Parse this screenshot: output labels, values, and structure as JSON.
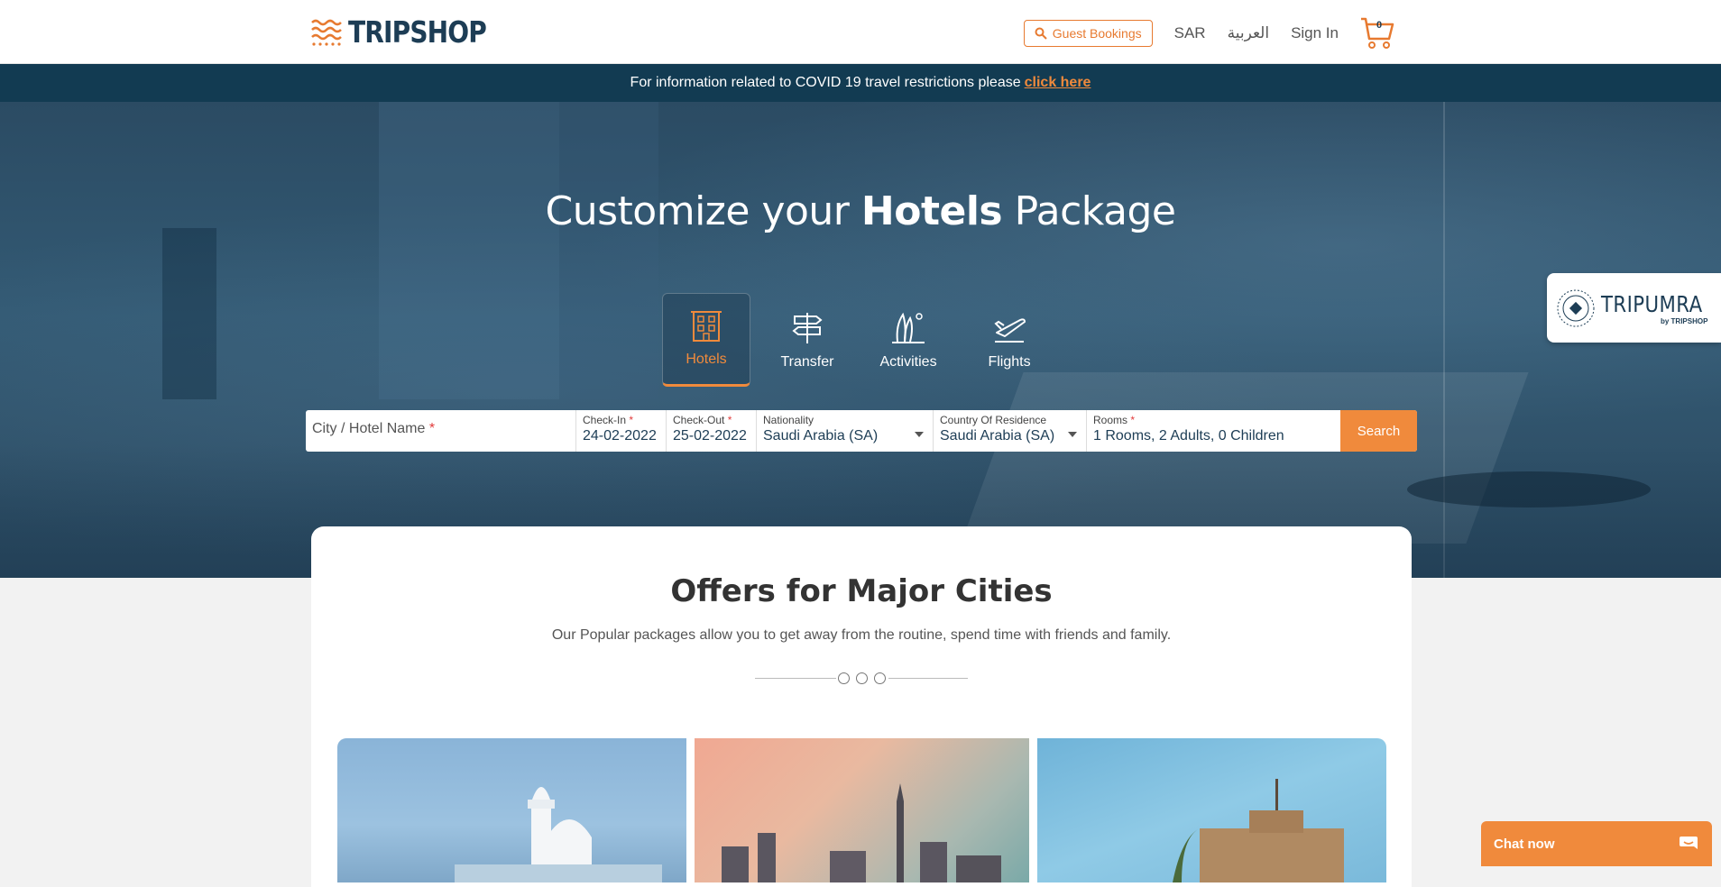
{
  "header": {
    "brand": "TRIPSHOP",
    "guest_bookings": "Guest Bookings",
    "currency": "SAR",
    "language": "العربية",
    "sign_in": "Sign In",
    "cart_count": "0"
  },
  "covid_banner": {
    "text": "For information related to COVID 19 travel restrictions please",
    "link": "click here"
  },
  "hero": {
    "title_pre": "Customize your ",
    "title_bold": "Hotels",
    "title_post": " Package"
  },
  "tabs": [
    {
      "label": "Hotels",
      "icon": "hotel-icon",
      "active": true
    },
    {
      "label": "Transfer",
      "icon": "signpost-icon",
      "active": false
    },
    {
      "label": "Activities",
      "icon": "beach-icon",
      "active": false
    },
    {
      "label": "Flights",
      "icon": "plane-icon",
      "active": false
    }
  ],
  "search": {
    "city_placeholder": "City / Hotel Name",
    "checkin_label": "Check-In",
    "checkin_value": "24-02-2022",
    "checkout_label": "Check-Out",
    "checkout_value": "25-02-2022",
    "nationality_label": "Nationality",
    "nationality_value": "Saudi Arabia (SA)",
    "residence_label": "Country Of Residence",
    "residence_value": "Saudi Arabia (SA)",
    "rooms_label": "Rooms",
    "rooms_value": "1 Rooms, 2 Adults, 0 Children",
    "button": "Search",
    "required_mark": "*"
  },
  "tripumra": {
    "name": "TRIPUMRA",
    "by": "by TRIPSHOP"
  },
  "offers": {
    "title": "Offers for Major Cities",
    "subtitle": "Our Popular packages allow you to get away from the routine, spend time with friends and family."
  },
  "chat": {
    "label": "Chat now"
  },
  "colors": {
    "accent": "#f08a3c",
    "brand_navy": "#1d3d55",
    "banner": "#123b52"
  }
}
